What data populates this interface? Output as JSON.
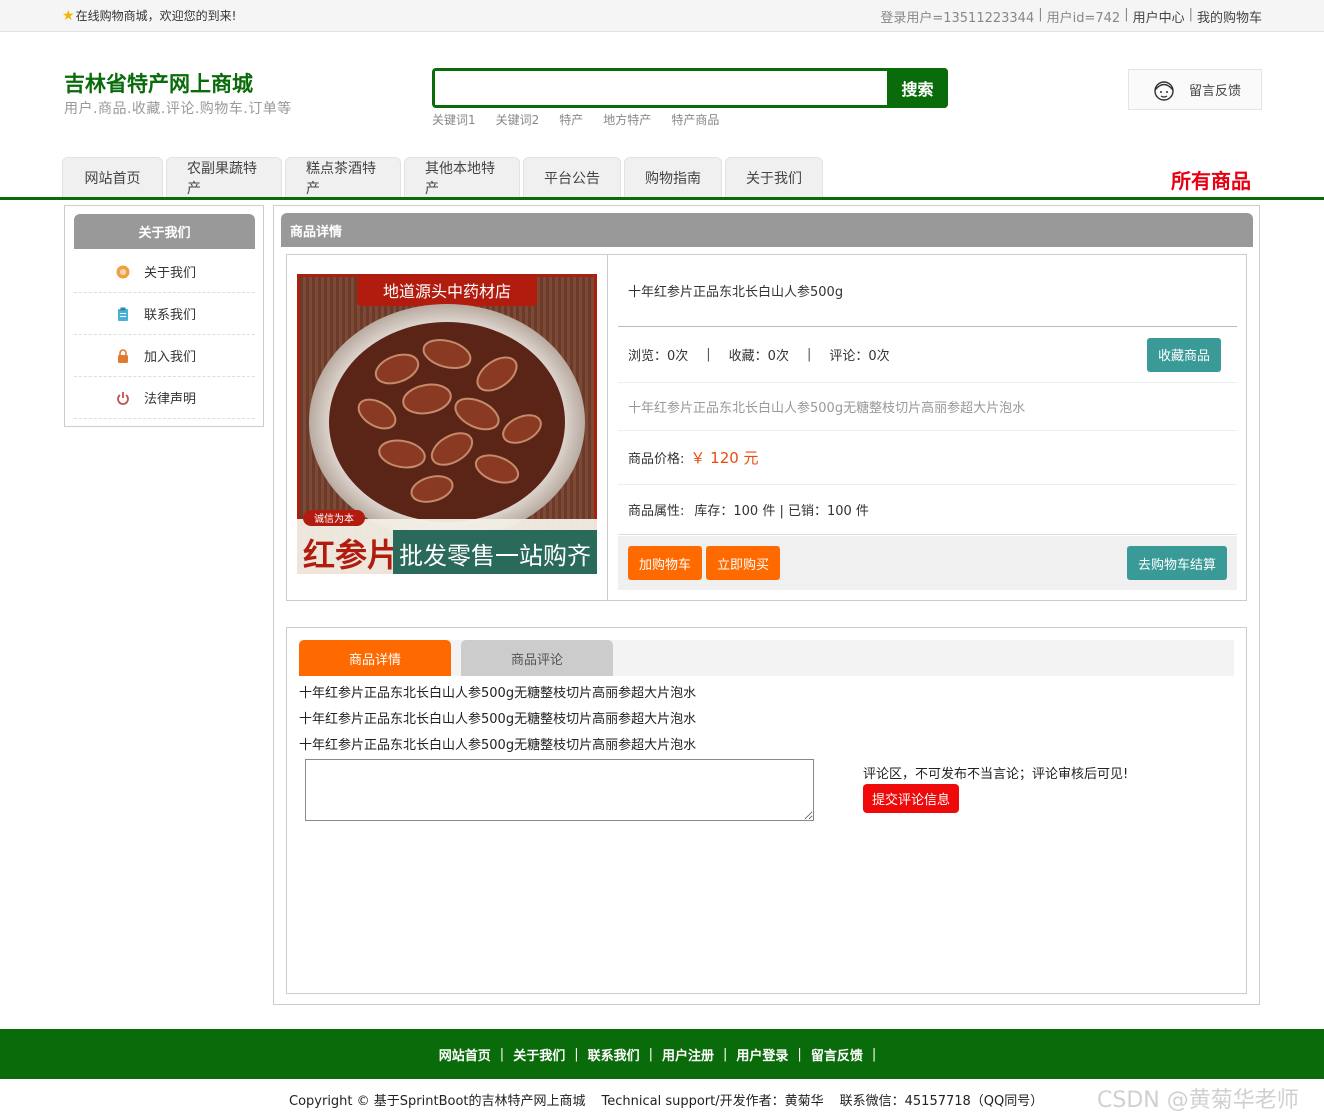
{
  "topbar": {
    "welcome": "在线购物商城，欢迎您的到来!",
    "login_user": "登录用户=13511223344",
    "user_id": "用户id=742",
    "user_center": "用户中心",
    "my_cart": "我的购物车"
  },
  "header": {
    "title": "吉林省特产网上商城",
    "subtitle": "用户.商品.收藏.评论.购物车.订单等",
    "search_button": "搜索",
    "search_value": "",
    "keywords": [
      "关键词1",
      "关键词2",
      "特产",
      "地方特产",
      "特产商品"
    ],
    "feedback": "留言反馈"
  },
  "nav": {
    "tabs": [
      "网站首页",
      "农副果蔬特产",
      "糕点茶酒特产",
      "其他本地特产",
      "平台公告",
      "购物指南",
      "关于我们"
    ],
    "all_goods": "所有商品"
  },
  "sidebar": {
    "title": "关于我们",
    "items": [
      {
        "label": "关于我们",
        "icon": "circle-icon",
        "color": "#f0a040"
      },
      {
        "label": "联系我们",
        "icon": "clipboard-icon",
        "color": "#4ab0d8"
      },
      {
        "label": "加入我们",
        "icon": "lock-icon",
        "color": "#e07a30"
      },
      {
        "label": "法律声明",
        "icon": "power-icon",
        "color": "#c05050"
      }
    ]
  },
  "main": {
    "title": "商品详情",
    "product": {
      "image_banner": "地道源头中药材店",
      "image_badge": "诚信为本",
      "image_big": "红参片",
      "image_slogan": "批发零售一站购齐",
      "name": "十年红参片正品东北长白山人参500g",
      "views": "浏览：0次",
      "favorites": "收藏：0次",
      "comments": "评论：0次",
      "favorite_button": "收藏商品",
      "description": "十年红参片正品东北长白山人参500g无糖整枝切片高丽参超大片泡水",
      "price_label": "商品价格:",
      "price_value": "￥ 120 元",
      "attr_label": "商品属性:",
      "attr_value": "库存：100 件 | 已销：100 件",
      "add_cart_button": "加购物车",
      "buy_now_button": "立即购买",
      "checkout_button": "去购物车结算"
    },
    "tabs": {
      "detail": "商品详情",
      "review": "商品评论"
    },
    "detail_lines": [
      "十年红参片正品东北长白山人参500g无糖整枝切片高丽参超大片泡水",
      "十年红参片正品东北长白山人参500g无糖整枝切片高丽参超大片泡水",
      "十年红参片正品东北长白山人参500g无糖整枝切片高丽参超大片泡水"
    ],
    "comment_value": "",
    "comment_note": "评论区，不可发布不当言论；评论审核后可见!",
    "submit_button": "提交评论信息"
  },
  "footer": {
    "links": [
      "网站首页",
      "关于我们",
      "联系我们",
      "用户注册",
      "用户登录",
      "留言反馈"
    ],
    "copyright": "Copyright © 基于SprintBoot的吉林特产网上商城",
    "support": "Technical support/开发作者：黄菊华",
    "contact": "联系微信：45157718（QQ同号）",
    "watermark": "CSDN @黄菊华老师"
  },
  "colors": {
    "brand_green": "#0a6b0a",
    "accent_orange": "#ff6a00",
    "teal": "#3a9a98",
    "red": "#e60012"
  }
}
